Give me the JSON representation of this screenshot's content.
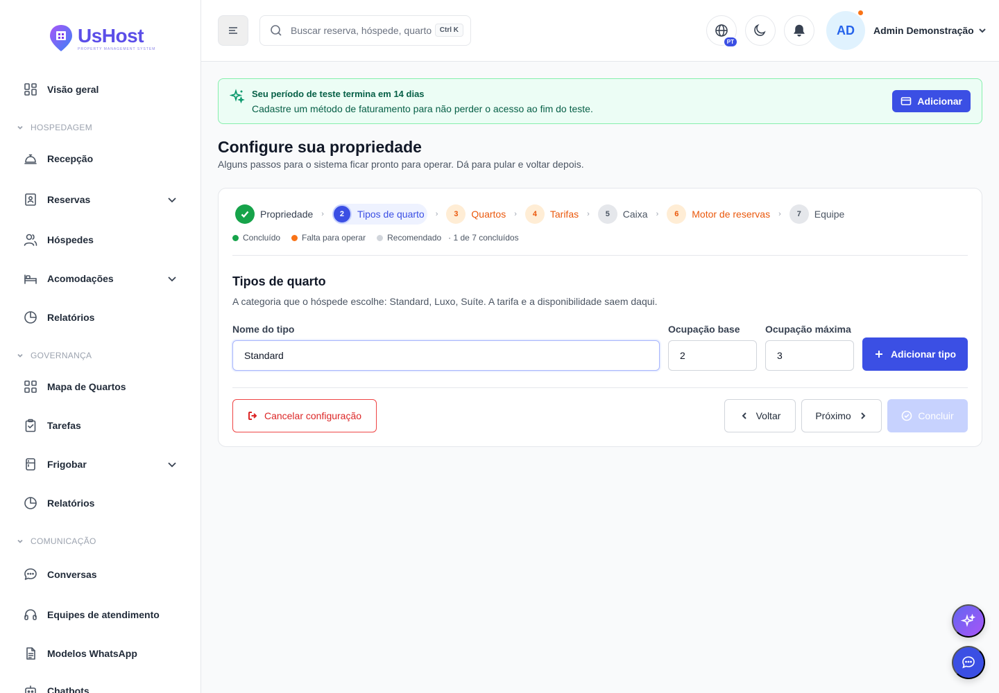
{
  "brand": {
    "name": "UsHost",
    "tagline": "PROPERTY MANAGEMENT SYSTEM",
    "color": "#5b4ee8"
  },
  "sidebar": {
    "overview": "Visão geral",
    "sections": {
      "hospedagem": "HOSPEDAGEM",
      "governanca": "GOVERNANÇA",
      "comunicacao": "COMUNICAÇÃO"
    },
    "items": {
      "recepcao": "Recepção",
      "reservas": "Reservas",
      "hospedes": "Hóspedes",
      "acomodacoes": "Acomodações",
      "relatorios1": "Relatórios",
      "mapa": "Mapa de Quartos",
      "tarefas": "Tarefas",
      "frigobar": "Frigobar",
      "relatorios2": "Relatórios",
      "conversas": "Conversas",
      "equipes": "Equipes de atendimento",
      "modelos": "Modelos WhatsApp",
      "chatbots": "Chatbots"
    }
  },
  "header": {
    "search_placeholder": "Buscar reserva, hóspede, quarto",
    "shortcut": "Ctrl K",
    "lang_badge": "PT",
    "avatar_initials": "AD",
    "user_name": "Admin Demonstração"
  },
  "banner": {
    "title": "Seu período de teste termina em 14 dias",
    "text": "Cadastre um método de faturamento para não perder o acesso ao fim do teste.",
    "button": "Adicionar"
  },
  "page": {
    "title": "Configure sua propriedade",
    "subtitle": "Alguns passos para o sistema ficar pronto para operar. Dá para pular e voltar depois."
  },
  "steps": [
    {
      "num": "1",
      "label": "Propriedade",
      "state": "done"
    },
    {
      "num": "2",
      "label": "Tipos de quarto",
      "state": "active"
    },
    {
      "num": "3",
      "label": "Quartos",
      "state": "required"
    },
    {
      "num": "4",
      "label": "Tarifas",
      "state": "required"
    },
    {
      "num": "5",
      "label": "Caixa",
      "state": "recommended"
    },
    {
      "num": "6",
      "label": "Motor de reservas",
      "state": "required"
    },
    {
      "num": "7",
      "label": "Equipe",
      "state": "recommended"
    }
  ],
  "legend": {
    "done": "Concluído",
    "required": "Falta para operar",
    "recommended": "Recomendado",
    "progress": "· 1 de 7 concluídos",
    "colors": {
      "done": "#16a34a",
      "required": "#f97316",
      "recommended": "#d1d5db"
    }
  },
  "form": {
    "title": "Tipos de quarto",
    "subtitle": "A categoria que o hóspede escolhe: Standard, Luxo, Suíte. A tarifa e a disponibilidade saem daqui.",
    "name_label": "Nome do tipo",
    "name_value": "Standard",
    "base_label": "Ocupação base",
    "base_value": "2",
    "max_label": "Ocupação máxima",
    "max_value": "3",
    "add_button": "Adicionar tipo"
  },
  "actions": {
    "cancel": "Cancelar configuração",
    "back": "Voltar",
    "next": "Próximo",
    "finish": "Concluir"
  }
}
